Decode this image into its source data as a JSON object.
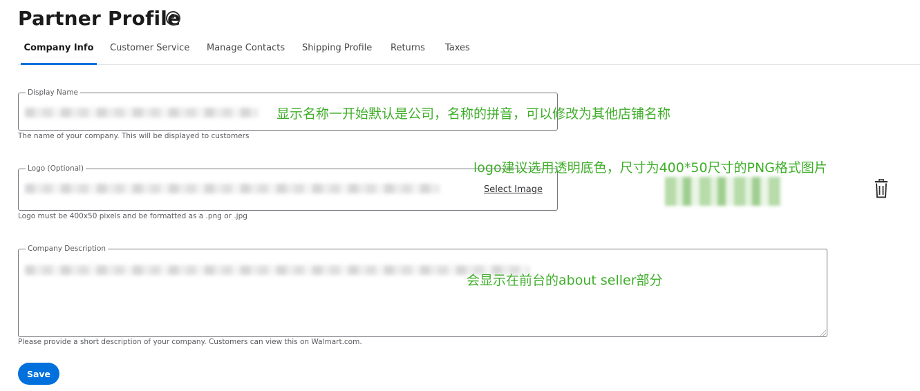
{
  "page": {
    "title": "Partner Profile",
    "help_icon": "help-circle-icon",
    "help_glyph": "?"
  },
  "tabs": [
    {
      "label": "Company Info",
      "active": true
    },
    {
      "label": "Customer Service",
      "active": false
    },
    {
      "label": "Manage Contacts",
      "active": false
    },
    {
      "label": "Shipping Profile",
      "active": false
    },
    {
      "label": "Returns",
      "active": false
    },
    {
      "label": "Taxes",
      "active": false
    }
  ],
  "fields": {
    "display_name": {
      "label": "Display Name",
      "helper": "The name of your company. This will be displayed to customers"
    },
    "logo": {
      "label": "Logo (Optional)",
      "select_label": "Select Image",
      "helper": "Logo must be 400x50 pixels and be formatted as a .png or .jpg",
      "delete_icon": "trash-icon"
    },
    "description": {
      "label": "Company Description",
      "helper": "Please provide a short description of your company. Customers can view this on Walmart.com."
    }
  },
  "annotations": {
    "display_name_note": "显示名称一开始默认是公司，名称的拼音，可以修改为其他店铺名称",
    "logo_note": "logo建议选用透明底色，尺寸为400*50尺寸的PNG格式图片",
    "description_note": "会显示在前台的about seller部分"
  },
  "actions": {
    "save_label": "Save"
  },
  "colors": {
    "accent": "#0071dc",
    "annotation": "#3fae2a",
    "border": "#74767c"
  }
}
